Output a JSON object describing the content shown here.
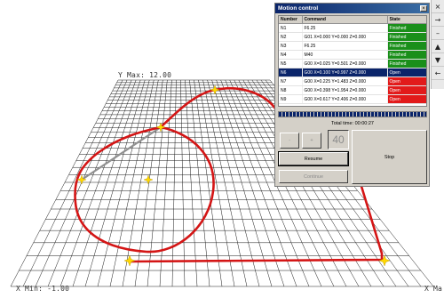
{
  "viewport": {
    "y_max_label": "Y Max: 12.00",
    "x_min_label": "X Min: -1.00",
    "x_max_label": "X Ma",
    "colors": {
      "grid": "#1a1a1a",
      "path": "#d41515",
      "travel": "#909090",
      "marker": "#ffd700"
    }
  },
  "toolbar": {
    "buttons": [
      {
        "name": "close-icon",
        "glyph": "×"
      },
      {
        "name": "arrow-right-icon",
        "glyph": "→"
      },
      {
        "name": "minimize-icon",
        "glyph": "–"
      },
      {
        "name": "arrow-up-icon",
        "glyph": "▲"
      },
      {
        "name": "arrow-down-icon",
        "glyph": "▼"
      },
      {
        "name": "arrow-left-icon",
        "glyph": "←"
      }
    ]
  },
  "motion": {
    "title": "Motion control",
    "columns": [
      "Number",
      "Command",
      "State"
    ],
    "rows": [
      {
        "number": "N1",
        "command": "F6.25",
        "state": "Finished"
      },
      {
        "number": "N2",
        "command": "G01 X=0.000 Y=0.000 Z=0.000",
        "state": "Finished"
      },
      {
        "number": "N3",
        "command": "F6.25",
        "state": "Finished"
      },
      {
        "number": "N4",
        "command": "M40",
        "state": "Finished"
      },
      {
        "number": "N5",
        "command": "G00 X=0.025 Y=0.501 Z=0.000",
        "state": "Finished"
      },
      {
        "number": "N6",
        "command": "G00 X=0.100 Y=0.997 Z=0.000",
        "state": "Open",
        "selected": true
      },
      {
        "number": "N7",
        "command": "G00 X=0.225 Y=1.483 Z=0.000",
        "state": "Open"
      },
      {
        "number": "N8",
        "command": "G00 X=0.398 Y=1.954 Z=0.000",
        "state": "Open"
      },
      {
        "number": "N9",
        "command": "G00 X=0.617 Y=2.406 Z=0.000",
        "state": "Open"
      }
    ],
    "progress": 1.0,
    "total_time": "Total time: 00:00:27",
    "minus_label": "-",
    "plus_label": "+",
    "speed_value": "40",
    "resume_label": "Resume",
    "continue_label": "Continue",
    "stop_label": "Stop"
  }
}
